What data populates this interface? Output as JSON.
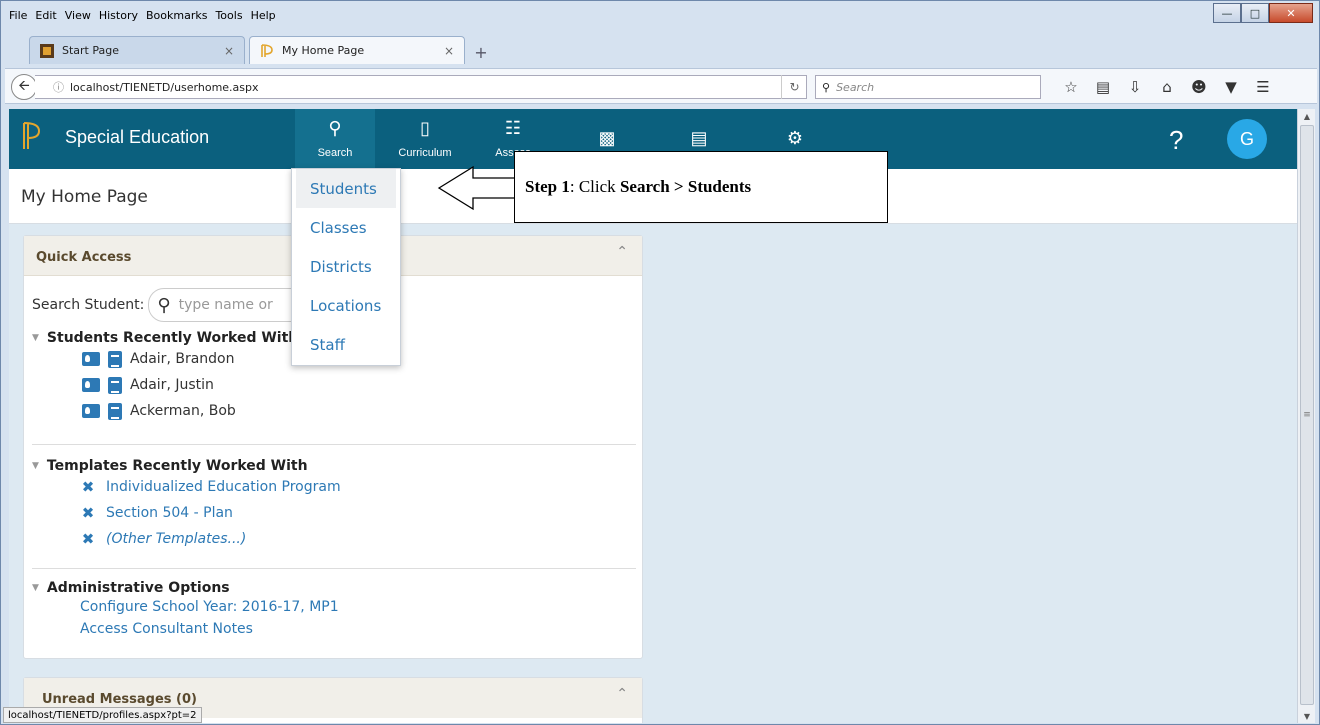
{
  "browser": {
    "menu": [
      "File",
      "Edit",
      "View",
      "History",
      "Bookmarks",
      "Tools",
      "Help"
    ],
    "tabs": [
      {
        "label": "Start Page",
        "active": false
      },
      {
        "label": "My Home Page",
        "active": true
      }
    ],
    "url": "localhost/TIENETD/userhome.aspx",
    "search_placeholder": "Search",
    "status_url": "localhost/TIENETD/profiles.aspx?pt=2"
  },
  "app": {
    "title": "Special Education",
    "nav": [
      {
        "label": "Search",
        "icon": "search-icon"
      },
      {
        "label": "Curriculum",
        "icon": "book-icon"
      },
      {
        "label": "Assess",
        "icon": "clipboard-icon"
      },
      {
        "label": "",
        "icon": "sitemap-icon"
      },
      {
        "label": "",
        "icon": "document-icon"
      },
      {
        "label": "",
        "icon": "gear-icon"
      }
    ],
    "help": "?",
    "avatar": "G",
    "accent": "#0b607e",
    "link_color": "#2d79b5"
  },
  "page": {
    "title": "My Home Page"
  },
  "dropdown": {
    "items": [
      "Students",
      "Classes",
      "Districts",
      "Locations",
      "Staff"
    ],
    "highlighted": "Students"
  },
  "callout": {
    "step": "Step 1",
    "text": ": Click ",
    "action": "Search > Students"
  },
  "quick_access": {
    "title": "Quick Access",
    "search_label": "Search Student:",
    "search_placeholder": "type name or",
    "students_heading": "Students Recently Worked With",
    "students": [
      "Adair, Brandon",
      "Adair, Justin",
      "Ackerman, Bob"
    ],
    "templates_heading": "Templates Recently Worked With",
    "templates": [
      "Individualized Education Program",
      "Section 504 - Plan",
      "(Other Templates...)"
    ],
    "admin_heading": "Administrative Options",
    "admin": [
      "Configure School Year: 2016-17, MP1",
      "Access Consultant Notes"
    ]
  },
  "unread": {
    "title": "Unread Messages (0)"
  }
}
